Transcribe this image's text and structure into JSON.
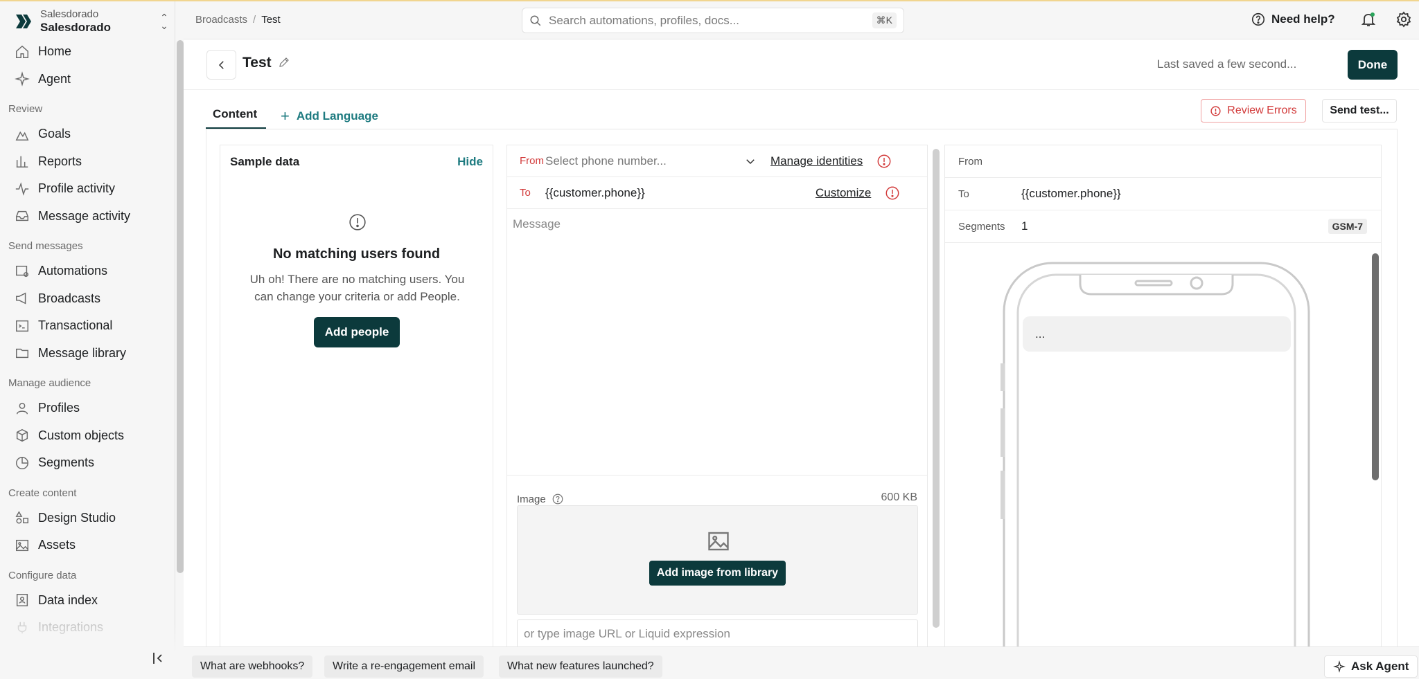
{
  "workspace": {
    "subtitle": "Salesdorado",
    "name": "Salesdorado"
  },
  "nav": {
    "home": "Home",
    "agent": "Agent",
    "section_review": "Review",
    "goals": "Goals",
    "reports": "Reports",
    "profile_activity": "Profile activity",
    "message_activity": "Message activity",
    "section_send": "Send messages",
    "automations": "Automations",
    "broadcasts": "Broadcasts",
    "transactional": "Transactional",
    "message_library": "Message library",
    "section_audience": "Manage audience",
    "profiles": "Profiles",
    "custom_objects": "Custom objects",
    "segments": "Segments",
    "section_content": "Create content",
    "design_studio": "Design Studio",
    "assets": "Assets",
    "section_data": "Configure data",
    "data_index": "Data index",
    "integrations": "Integrations"
  },
  "topbar": {
    "breadcrumb": [
      "Broadcasts",
      "Test"
    ],
    "search_placeholder": "Search automations, profiles, docs...",
    "search_shortcut": "⌘K",
    "help": "Need help?"
  },
  "header": {
    "title": "Test",
    "saved_status": "Last saved a few second...",
    "done": "Done"
  },
  "tabs": {
    "content": "Content",
    "add_language": "Add Language",
    "review_errors": "Review Errors",
    "send_test": "Send test..."
  },
  "sample_data": {
    "title": "Sample data",
    "hide": "Hide",
    "empty_title": "No matching users found",
    "empty_desc": "Uh oh! There are no matching users. You can change your criteria or add People.",
    "add_people": "Add people"
  },
  "compose": {
    "from_label": "From",
    "from_placeholder": "Select phone number...",
    "manage_identities": "Manage identities",
    "to_label": "To",
    "to_value": "{{customer.phone}}",
    "customize": "Customize",
    "message_placeholder": "Message",
    "image_label": "Image",
    "image_size": "600 KB",
    "add_image": "Add image from library",
    "url_placeholder": "or type image URL or Liquid expression"
  },
  "preview": {
    "from_label": "From",
    "to_label": "To",
    "to_value": "{{customer.phone}}",
    "segments_label": "Segments",
    "segments_value": "1",
    "encoding": "GSM-7",
    "bubble_text": "..."
  },
  "bottom": {
    "chips": [
      "What are webhooks?",
      "Write a re-engagement email",
      "What new features launched?"
    ],
    "ask_agent": "Ask Agent"
  }
}
